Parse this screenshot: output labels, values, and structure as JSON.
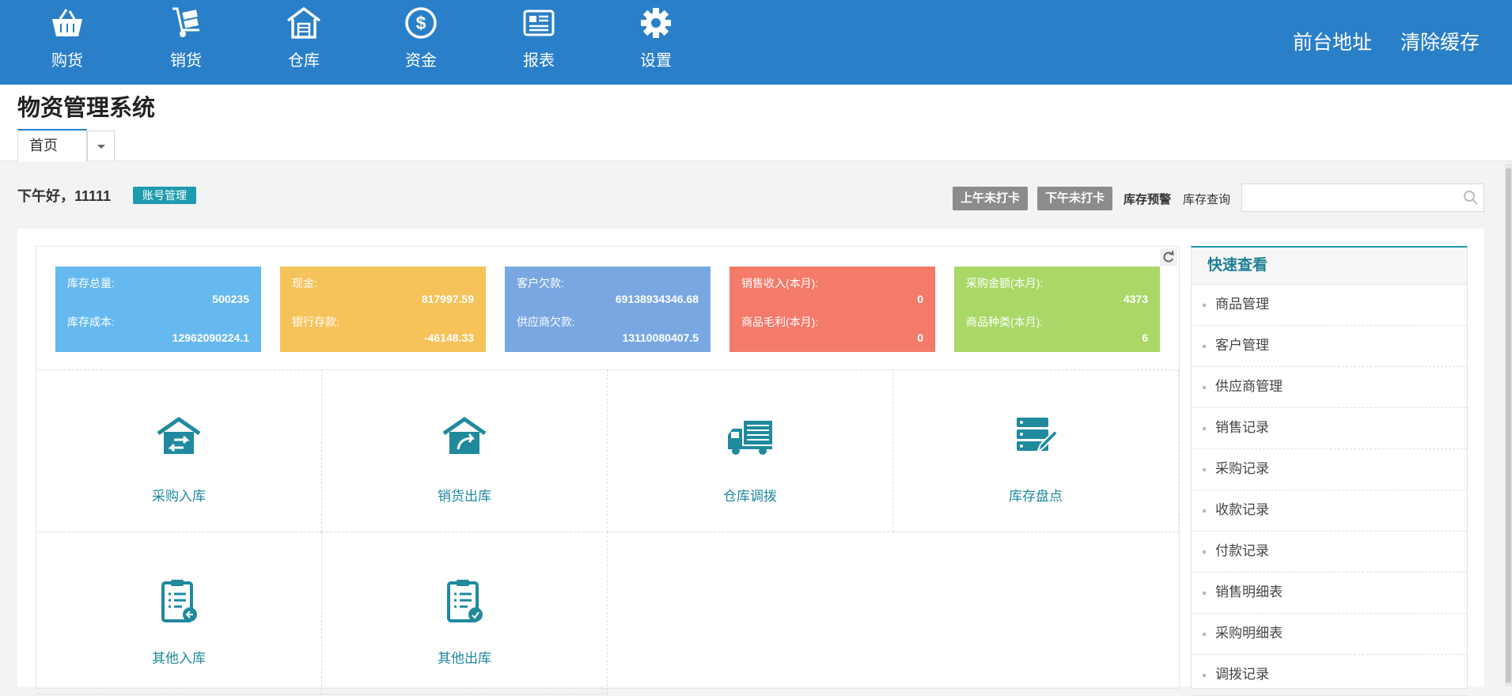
{
  "nav": {
    "items": [
      {
        "label": "购货",
        "icon": "basket-icon"
      },
      {
        "label": "销货",
        "icon": "hand-truck-icon"
      },
      {
        "label": "仓库",
        "icon": "warehouse-icon"
      },
      {
        "label": "资金",
        "icon": "dollar-icon"
      },
      {
        "label": "报表",
        "icon": "report-icon"
      },
      {
        "label": "设置",
        "icon": "gear-icon"
      }
    ],
    "front_address": "前台地址",
    "clear_cache": "清除缓存"
  },
  "header": {
    "title": "物资管理系统",
    "tab_home": "首页"
  },
  "greeting": {
    "text": "下午好，11111",
    "account_button": "账号管理"
  },
  "toolbar": {
    "am_clock": "上午未打卡",
    "pm_clock": "下午未打卡",
    "stock_warning": "库存预警",
    "stock_query": "库存查询",
    "search_placeholder": ""
  },
  "stats": [
    {
      "color": "#66b9ee",
      "rows": [
        {
          "label": "库存总量:",
          "value": "500235"
        },
        {
          "label": "库存成本:",
          "value": "12962090224.1"
        }
      ]
    },
    {
      "color": "#f6c35b",
      "rows": [
        {
          "label": "现金:",
          "value": "817997.59"
        },
        {
          "label": "银行存款:",
          "value": "-46148.33"
        }
      ]
    },
    {
      "color": "#78a7e2",
      "rows": [
        {
          "label": "客户欠款:",
          "value": "69138934346.68"
        },
        {
          "label": "供应商欠款:",
          "value": "13110080407.5"
        }
      ]
    },
    {
      "color": "#f47a6a",
      "rows": [
        {
          "label": "销售收入(本月):",
          "value": "0"
        },
        {
          "label": "商品毛利(本月):",
          "value": "0"
        }
      ]
    },
    {
      "color": "#a9d866",
      "rows": [
        {
          "label": "采购金额(本月):",
          "value": "4373"
        },
        {
          "label": "商品种类(本月):",
          "value": "6"
        }
      ]
    }
  ],
  "quick_actions": [
    {
      "label": "采购入库",
      "icon": "purchase-in-icon"
    },
    {
      "label": "销货出库",
      "icon": "sales-out-icon"
    },
    {
      "label": "仓库调拨",
      "icon": "truck-icon"
    },
    {
      "label": "库存盘点",
      "icon": "inventory-icon"
    },
    {
      "label": "其他入库",
      "icon": "clipboard-in-icon"
    },
    {
      "label": "其他出库",
      "icon": "clipboard-out-icon"
    }
  ],
  "side_panel": {
    "title": "快速查看",
    "items": [
      "商品管理",
      "客户管理",
      "供应商管理",
      "销售记录",
      "采购记录",
      "收款记录",
      "付款记录",
      "销售明细表",
      "采购明细表",
      "调拨记录"
    ]
  },
  "colors": {
    "nav_bg": "#2a7fc9",
    "accent": "#1f9bb0"
  }
}
